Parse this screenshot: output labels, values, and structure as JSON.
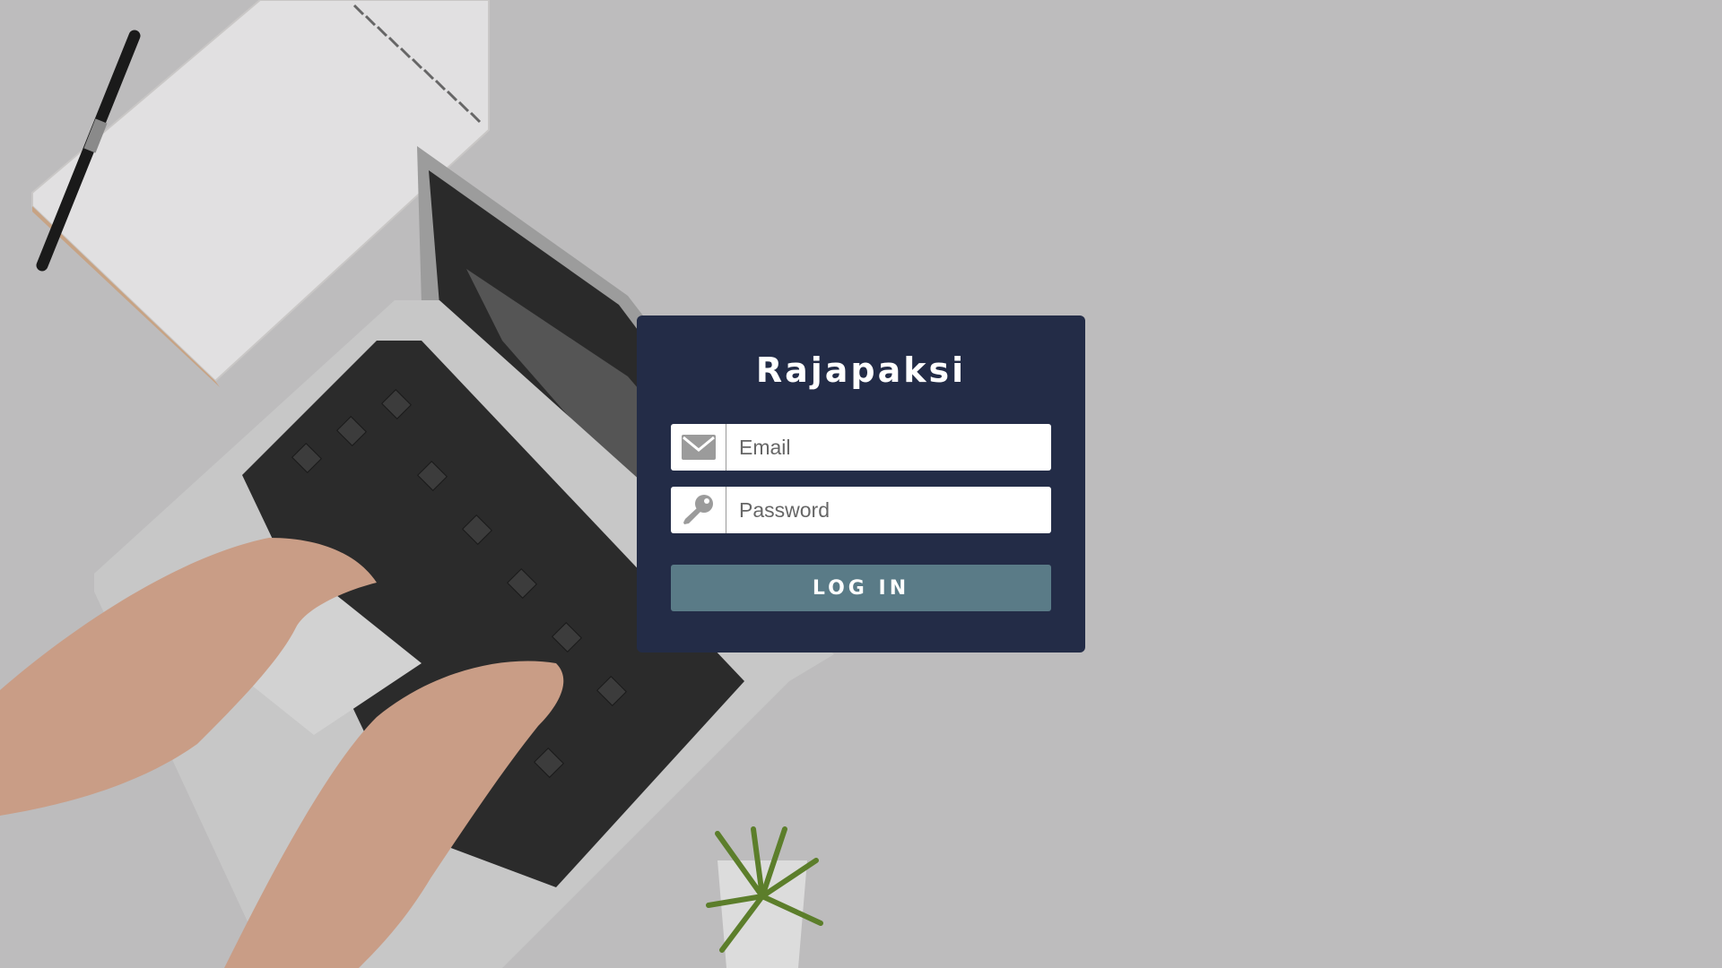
{
  "app": {
    "title": "Rajapaksi"
  },
  "login_form": {
    "email": {
      "placeholder": "Email",
      "value": "",
      "icon": "envelope-icon"
    },
    "password": {
      "placeholder": "Password",
      "value": "",
      "icon": "key-icon"
    },
    "submit_label": "LOG IN"
  },
  "colors": {
    "card_background": "#232c47",
    "button_background": "#5a7b87",
    "page_background": "#bdbcbd",
    "icon_color": "#9b9b9b"
  }
}
